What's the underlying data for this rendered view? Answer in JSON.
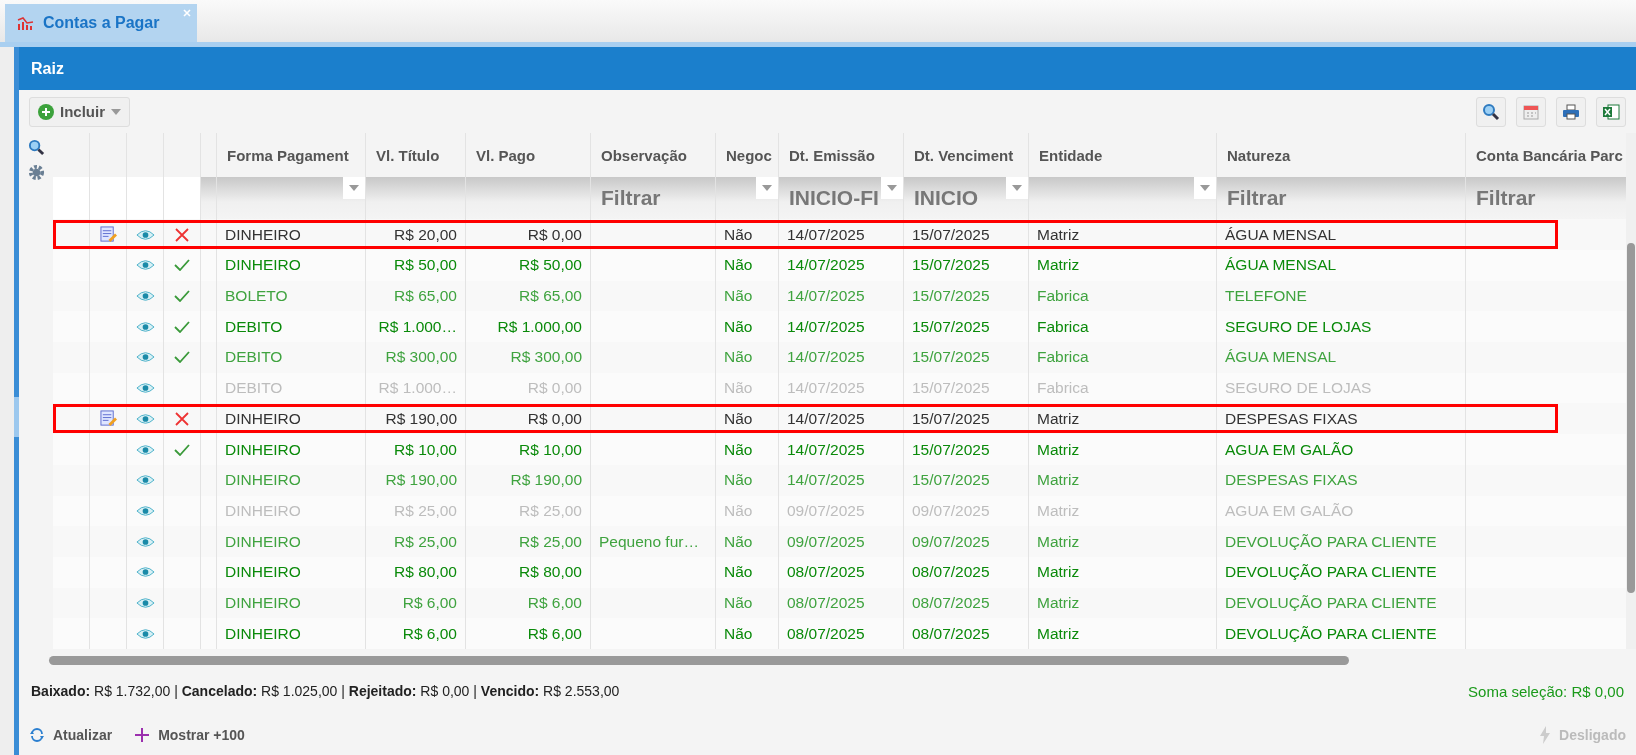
{
  "tabs": [
    {
      "label": "Contas a Pagar",
      "selected": true
    }
  ],
  "panel": {
    "title": "Raiz"
  },
  "toolbar": {
    "include_button": "Incluir"
  },
  "columns": [
    {
      "label": "Forma Pagament",
      "dropdown": true
    },
    {
      "label": "Vl. Título",
      "dropdown": false
    },
    {
      "label": "Vl. Pago",
      "dropdown": false
    },
    {
      "label": "Observação",
      "filter": "Filtrar",
      "dropdown": false
    },
    {
      "label": "Negoc",
      "dropdown": true
    },
    {
      "label": "Dt. Emissão",
      "filter": "INICIO-FI",
      "dropdown": true
    },
    {
      "label": "Dt. Venciment",
      "filter": "INICIO",
      "dropdown": true
    },
    {
      "label": "Entidade",
      "dropdown": true
    },
    {
      "label": "Natureza",
      "filter": "Filtrar",
      "dropdown": false
    },
    {
      "label": "Conta Bancária Parc",
      "filter": "Filtrar",
      "dropdown": false
    }
  ],
  "rows": [
    {
      "color": "#333333",
      "highlighted": true,
      "editable": true,
      "kind": "cancel",
      "forma_pagamento": "DINHEIRO",
      "vl_titulo": "R$ 20,00",
      "vl_pago": "R$ 0,00",
      "negoc": "Não",
      "dt_emissao": "14/07/2025",
      "dt_vencimento": "15/07/2025",
      "entidade": "Matriz",
      "natureza": "ÁGUA MENSAL"
    },
    {
      "color": "#0a8a0a",
      "highlighted": false,
      "editable": false,
      "kind": "check",
      "forma_pagamento": "DINHEIRO",
      "vl_titulo": "R$ 50,00",
      "vl_pago": "R$ 50,00",
      "negoc": "Não",
      "dt_emissao": "14/07/2025",
      "dt_vencimento": "15/07/2025",
      "entidade": "Matriz",
      "natureza": "ÁGUA MENSAL"
    },
    {
      "color": "#3fa33f",
      "highlighted": false,
      "editable": false,
      "kind": "check",
      "forma_pagamento": "BOLETO",
      "vl_titulo": "R$ 65,00",
      "vl_pago": "R$ 65,00",
      "negoc": "Não",
      "dt_emissao": "14/07/2025",
      "dt_vencimento": "15/07/2025",
      "entidade": "Fabrica",
      "natureza": "TELEFONE"
    },
    {
      "color": "#0a8a0a",
      "highlighted": false,
      "editable": false,
      "kind": "check",
      "forma_pagamento": "DEBITO",
      "vl_titulo": "R$ 1.000…",
      "vl_pago": "R$ 1.000,00",
      "negoc": "Não",
      "dt_emissao": "14/07/2025",
      "dt_vencimento": "15/07/2025",
      "entidade": "Fabrica",
      "natureza": "SEGURO DE LOJAS"
    },
    {
      "color": "#3fa33f",
      "highlighted": false,
      "editable": false,
      "kind": "check",
      "forma_pagamento": "DEBITO",
      "vl_titulo": "R$ 300,00",
      "vl_pago": "R$ 300,00",
      "negoc": "Não",
      "dt_emissao": "14/07/2025",
      "dt_vencimento": "15/07/2025",
      "entidade": "Fabrica",
      "natureza": "ÁGUA MENSAL"
    },
    {
      "color": "#bdbdbd",
      "highlighted": false,
      "editable": false,
      "kind": "none",
      "forma_pagamento": "DEBITO",
      "vl_titulo": "R$ 1.000…",
      "vl_pago": "R$ 0,00",
      "negoc": "Não",
      "dt_emissao": "14/07/2025",
      "dt_vencimento": "15/07/2025",
      "entidade": "Fabrica",
      "natureza": "SEGURO DE LOJAS"
    },
    {
      "color": "#333333",
      "highlighted": true,
      "editable": true,
      "kind": "cancel",
      "forma_pagamento": "DINHEIRO",
      "vl_titulo": "R$ 190,00",
      "vl_pago": "R$ 0,00",
      "negoc": "Não",
      "dt_emissao": "14/07/2025",
      "dt_vencimento": "15/07/2025",
      "entidade": "Matriz",
      "natureza": "DESPESAS FIXAS"
    },
    {
      "color": "#0a8a0a",
      "highlighted": false,
      "editable": false,
      "kind": "check",
      "forma_pagamento": "DINHEIRO",
      "vl_titulo": "R$ 10,00",
      "vl_pago": "R$ 10,00",
      "negoc": "Não",
      "dt_emissao": "14/07/2025",
      "dt_vencimento": "15/07/2025",
      "entidade": "Matriz",
      "natureza": "AGUA EM GALÃO"
    },
    {
      "color": "#3fa33f",
      "highlighted": false,
      "editable": false,
      "kind": "none",
      "forma_pagamento": "DINHEIRO",
      "vl_titulo": "R$ 190,00",
      "vl_pago": "R$ 190,00",
      "negoc": "Não",
      "dt_emissao": "14/07/2025",
      "dt_vencimento": "15/07/2025",
      "entidade": "Matriz",
      "natureza": "DESPESAS FIXAS"
    },
    {
      "color": "#bdbdbd",
      "highlighted": false,
      "editable": false,
      "kind": "none",
      "forma_pagamento": "DINHEIRO",
      "vl_titulo": "R$ 25,00",
      "vl_pago": "R$ 25,00",
      "negoc": "Não",
      "dt_emissao": "09/07/2025",
      "dt_vencimento": "09/07/2025",
      "entidade": "Matriz",
      "natureza": "AGUA EM GALÃO"
    },
    {
      "color": "#3fa33f",
      "highlighted": false,
      "editable": false,
      "kind": "none",
      "forma_pagamento": "DINHEIRO",
      "vl_titulo": "R$ 25,00",
      "vl_pago": "R$ 25,00",
      "observacao": "Pequeno fur…",
      "negoc": "Não",
      "dt_emissao": "09/07/2025",
      "dt_vencimento": "09/07/2025",
      "entidade": "Matriz",
      "natureza": "DEVOLUÇÃO PARA CLIENTE"
    },
    {
      "color": "#0a8a0a",
      "highlighted": false,
      "editable": false,
      "kind": "none",
      "forma_pagamento": "DINHEIRO",
      "vl_titulo": "R$ 80,00",
      "vl_pago": "R$ 80,00",
      "negoc": "Não",
      "dt_emissao": "08/07/2025",
      "dt_vencimento": "08/07/2025",
      "entidade": "Matriz",
      "natureza": "DEVOLUÇÃO PARA CLIENTE"
    },
    {
      "color": "#3fa33f",
      "highlighted": false,
      "editable": false,
      "kind": "none",
      "forma_pagamento": "DINHEIRO",
      "vl_titulo": "R$ 6,00",
      "vl_pago": "R$ 6,00",
      "negoc": "Não",
      "dt_emissao": "08/07/2025",
      "dt_vencimento": "08/07/2025",
      "entidade": "Matriz",
      "natureza": "DEVOLUÇÃO PARA CLIENTE"
    },
    {
      "color": "#0a8a0a",
      "highlighted": false,
      "editable": false,
      "kind": "none",
      "forma_pagamento": "DINHEIRO",
      "vl_titulo": "R$ 6,00",
      "vl_pago": "R$ 6,00",
      "negoc": "Não",
      "dt_emissao": "08/07/2025",
      "dt_vencimento": "08/07/2025",
      "entidade": "Matriz",
      "natureza": "DEVOLUÇÃO PARA CLIENTE"
    }
  ],
  "summary": {
    "totals": "**Baixado:** R$ 1.732,00 | **Cancelado:** R$ 1.025,00 | **Rejeitado:** R$ 0,00 | **Vencido:** R$ 2.553,00",
    "selection": "Soma seleção: R$ 0,00"
  },
  "footer_buttons": [
    {
      "kind": "refresh",
      "label": "Atualizar",
      "disabled": false
    },
    {
      "kind": "more",
      "label": "Mostrar +100",
      "disabled": false
    },
    {
      "kind": "power",
      "label": "Desligado",
      "disabled": true
    }
  ]
}
